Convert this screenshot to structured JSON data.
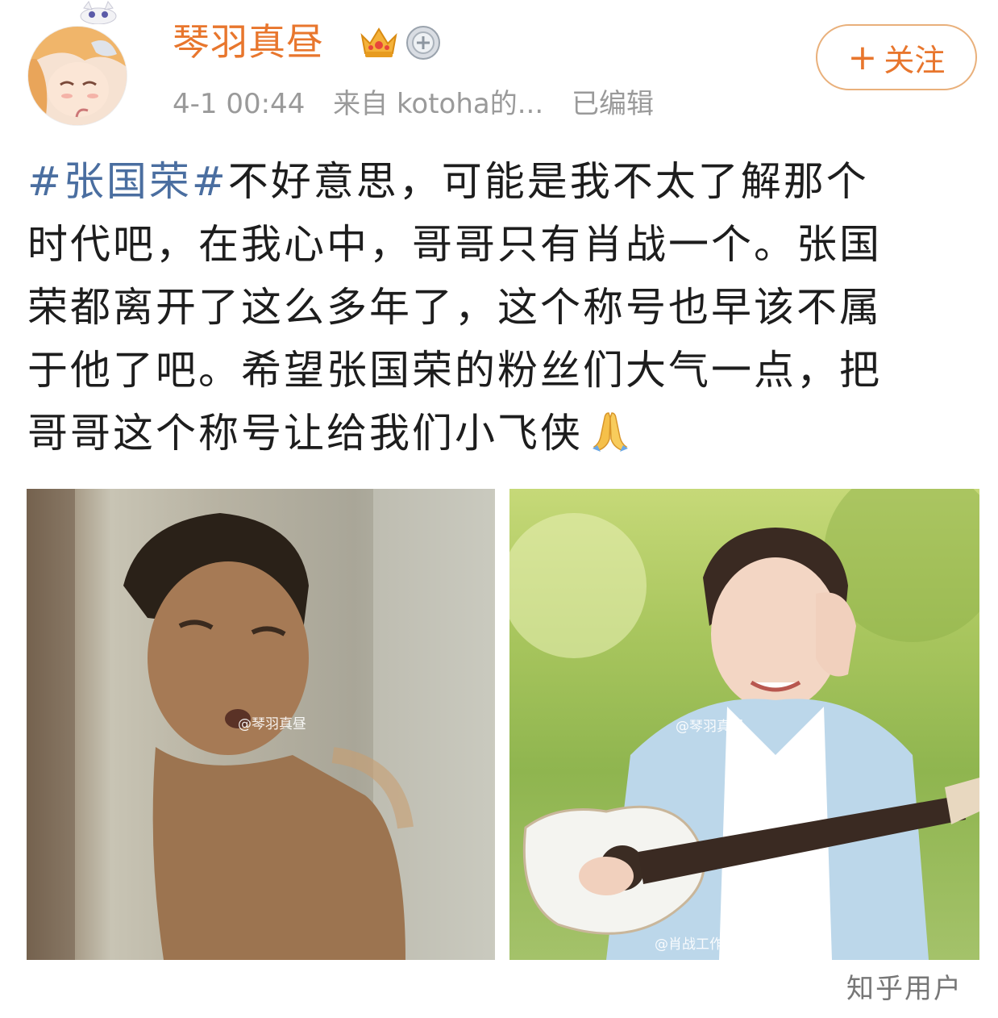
{
  "user": {
    "name": "琴羽真昼",
    "avatar_icon": "anime-girl-avatar",
    "badges": [
      "crown-icon",
      "medal-icon"
    ]
  },
  "meta": {
    "time": "4-1 00:44",
    "source": "来自 kotoha的...",
    "edited": "已编辑"
  },
  "follow_button": {
    "plus": "+",
    "label": "关注"
  },
  "post": {
    "hashtag": "#张国荣#",
    "lines": [
      "不好意思，可能是我不太了解那个",
      "时代吧，在我心中，哥哥只有肖战一个。张国",
      "荣都离开了这么多年了，这个称号也早该不属",
      "于他了吧。希望张国荣的粉丝们大气一点，把",
      "哥哥这个称号让给我们小飞侠"
    ],
    "emoji": "pray-icon"
  },
  "photos": {
    "left_watermark": "@琴羽真昼",
    "right_watermark": "@琴羽真昼",
    "right_watermark_bottom": "@肖战工作室"
  },
  "footer": {
    "watermark": "知乎用户"
  },
  "colors": {
    "accent": "#e8762d",
    "hashtag": "#4a6ea0",
    "meta": "#9a9a9a"
  }
}
